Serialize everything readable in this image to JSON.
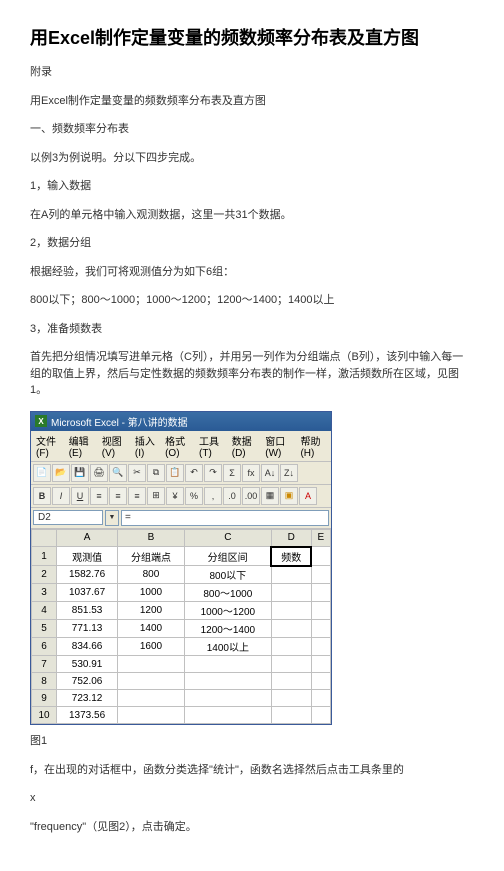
{
  "title": "用Excel制作定量变量的频数频率分布表及直方图",
  "paras": {
    "p1": "附录",
    "p2": "用Excel制作定量变量的频数频率分布表及直方图",
    "p3": "一、频数频率分布表",
    "p4": "以例3为例说明。分以下四步完成。",
    "p5": "1，输入数据",
    "p6": "在A列的单元格中输入观测数据，这里一共31个数据。",
    "p7": "2，数据分组",
    "p8": "根据经验，我们可将观测值分为如下6组：",
    "p9": "800以下；800～1000；1000～1200；1200～1400；1400以上",
    "p10": "3，准备频数表",
    "p11": "首先把分组情况填写进单元格（C列），并用另一列作为分组端点（B列），该列中输入每一组的取值上界，然后与定性数据的频数频率分布表的制作一样，激活频数所在区域，见图1。",
    "p12": "图1",
    "p13": "f，在出现的对话框中，函数分类选择\"统计\"，函数名选择然后点击工具条里的",
    "p14": "x",
    "p15": "\"frequency\"（见图2），点击确定。"
  },
  "excel": {
    "title": "Microsoft Excel - 第八讲的数据",
    "menus": [
      "文件(F)",
      "编辑(E)",
      "视图(V)",
      "插入(I)",
      "格式(O)",
      "工具(T)",
      "数据(D)",
      "窗口(W)",
      "帮助(H)"
    ],
    "namebox": "D2",
    "formula": "=",
    "cols": [
      "",
      "A",
      "B",
      "C",
      "D",
      "E"
    ],
    "rows": [
      {
        "h": "1",
        "cells": [
          "观测值",
          "分组端点",
          "分组区间",
          "频数",
          ""
        ]
      },
      {
        "h": "2",
        "cells": [
          "1582.76",
          "800",
          "800以下",
          "",
          ""
        ]
      },
      {
        "h": "3",
        "cells": [
          "1037.67",
          "1000",
          "800～1000",
          "",
          ""
        ]
      },
      {
        "h": "4",
        "cells": [
          "851.53",
          "1200",
          "1000～1200",
          "",
          ""
        ]
      },
      {
        "h": "5",
        "cells": [
          "771.13",
          "1400",
          "1200～1400",
          "",
          ""
        ]
      },
      {
        "h": "6",
        "cells": [
          "834.66",
          "1600",
          "1400以上",
          "",
          ""
        ]
      },
      {
        "h": "7",
        "cells": [
          "530.91",
          "",
          "",
          "",
          ""
        ]
      },
      {
        "h": "8",
        "cells": [
          "752.06",
          "",
          "",
          "",
          ""
        ]
      },
      {
        "h": "9",
        "cells": [
          "723.12",
          "",
          "",
          "",
          ""
        ]
      },
      {
        "h": "10",
        "cells": [
          "1373.56",
          "",
          "",
          "",
          ""
        ]
      }
    ]
  }
}
